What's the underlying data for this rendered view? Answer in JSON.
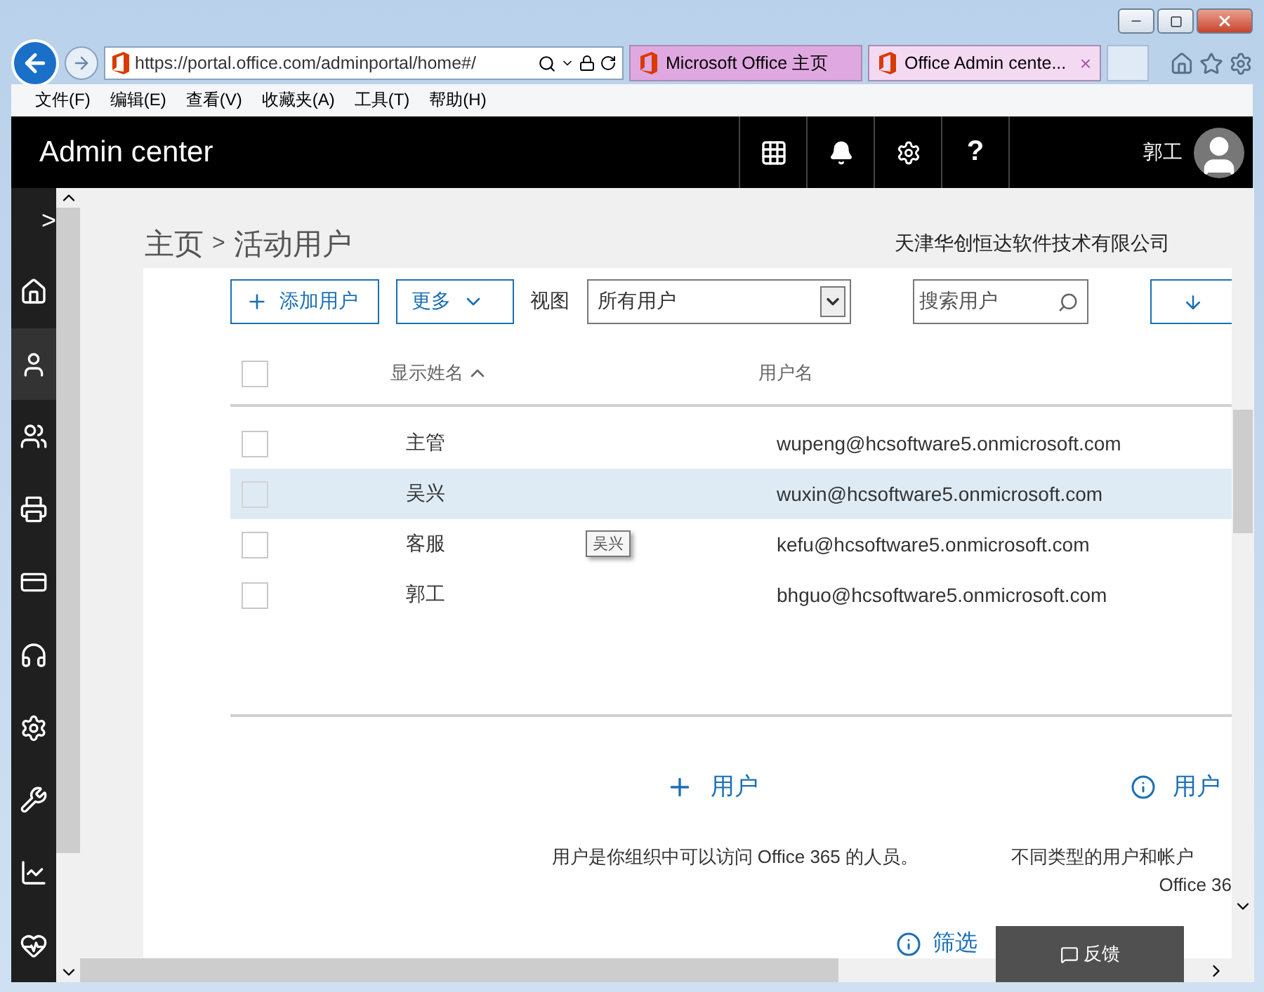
{
  "browser": {
    "address": "https://portal.office.com/adminportal/home#/",
    "tabs": [
      {
        "title": "Microsoft Office 主页",
        "selected": false
      },
      {
        "title": "Office Admin cente...",
        "selected": true,
        "close": "×"
      }
    ],
    "menu": [
      "文件(F)",
      "编辑(E)",
      "查看(V)",
      "收藏夹(A)",
      "工具(T)",
      "帮助(H)"
    ]
  },
  "header": {
    "title": "Admin center",
    "user": "郭工",
    "help": "?"
  },
  "sidebar": {
    "expand": ">",
    "items": [
      {
        "selected": false
      },
      {
        "selected": true
      },
      {
        "selected": false
      },
      {
        "selected": false
      },
      {
        "selected": false
      },
      {
        "selected": false
      },
      {
        "selected": false
      },
      {
        "selected": false
      },
      {
        "selected": false
      },
      {
        "selected": false
      }
    ]
  },
  "breadcrumb": {
    "items": [
      "主页",
      "活动用户"
    ],
    "separator": ">"
  },
  "company": "天津华创恒达软件技术有限公司",
  "toolbar": {
    "add": "添加用户",
    "more": "更多",
    "view_label": "视图",
    "view_value": "所有用户",
    "search_placeholder": "搜索用户"
  },
  "table": {
    "select_all": {
      "checked": false
    },
    "columns": [
      {
        "label": "显示姓名",
        "sorted": true
      },
      {
        "label": "用户名",
        "sorted": false
      }
    ],
    "rows": [
      {
        "name": "主管",
        "email": "wupeng@hcsoftware5.onmicrosoft.com",
        "selected": false,
        "checked": false
      },
      {
        "name": "吴兴",
        "email": "wuxin@hcsoftware5.onmicrosoft.com",
        "selected": true,
        "checked": false
      },
      {
        "name": "客服",
        "email": "kefu@hcsoftware5.onmicrosoft.com",
        "selected": false,
        "checked": false
      },
      {
        "name": "郭工",
        "email": "bhguo@hcsoftware5.onmicrosoft.com",
        "selected": false,
        "checked": false
      }
    ],
    "tooltip": "吴兴"
  },
  "info": [
    {
      "kind": "add",
      "title": "用户",
      "lines": [
        "用户是你组织中可以访问 Office 365 的人员。"
      ]
    },
    {
      "kind": "info",
      "title": "用户",
      "lines": [
        "不同类型的用户和帐户",
        "Office 36"
      ]
    }
  ],
  "filter_link": "筛选",
  "feedback": "反馈"
}
